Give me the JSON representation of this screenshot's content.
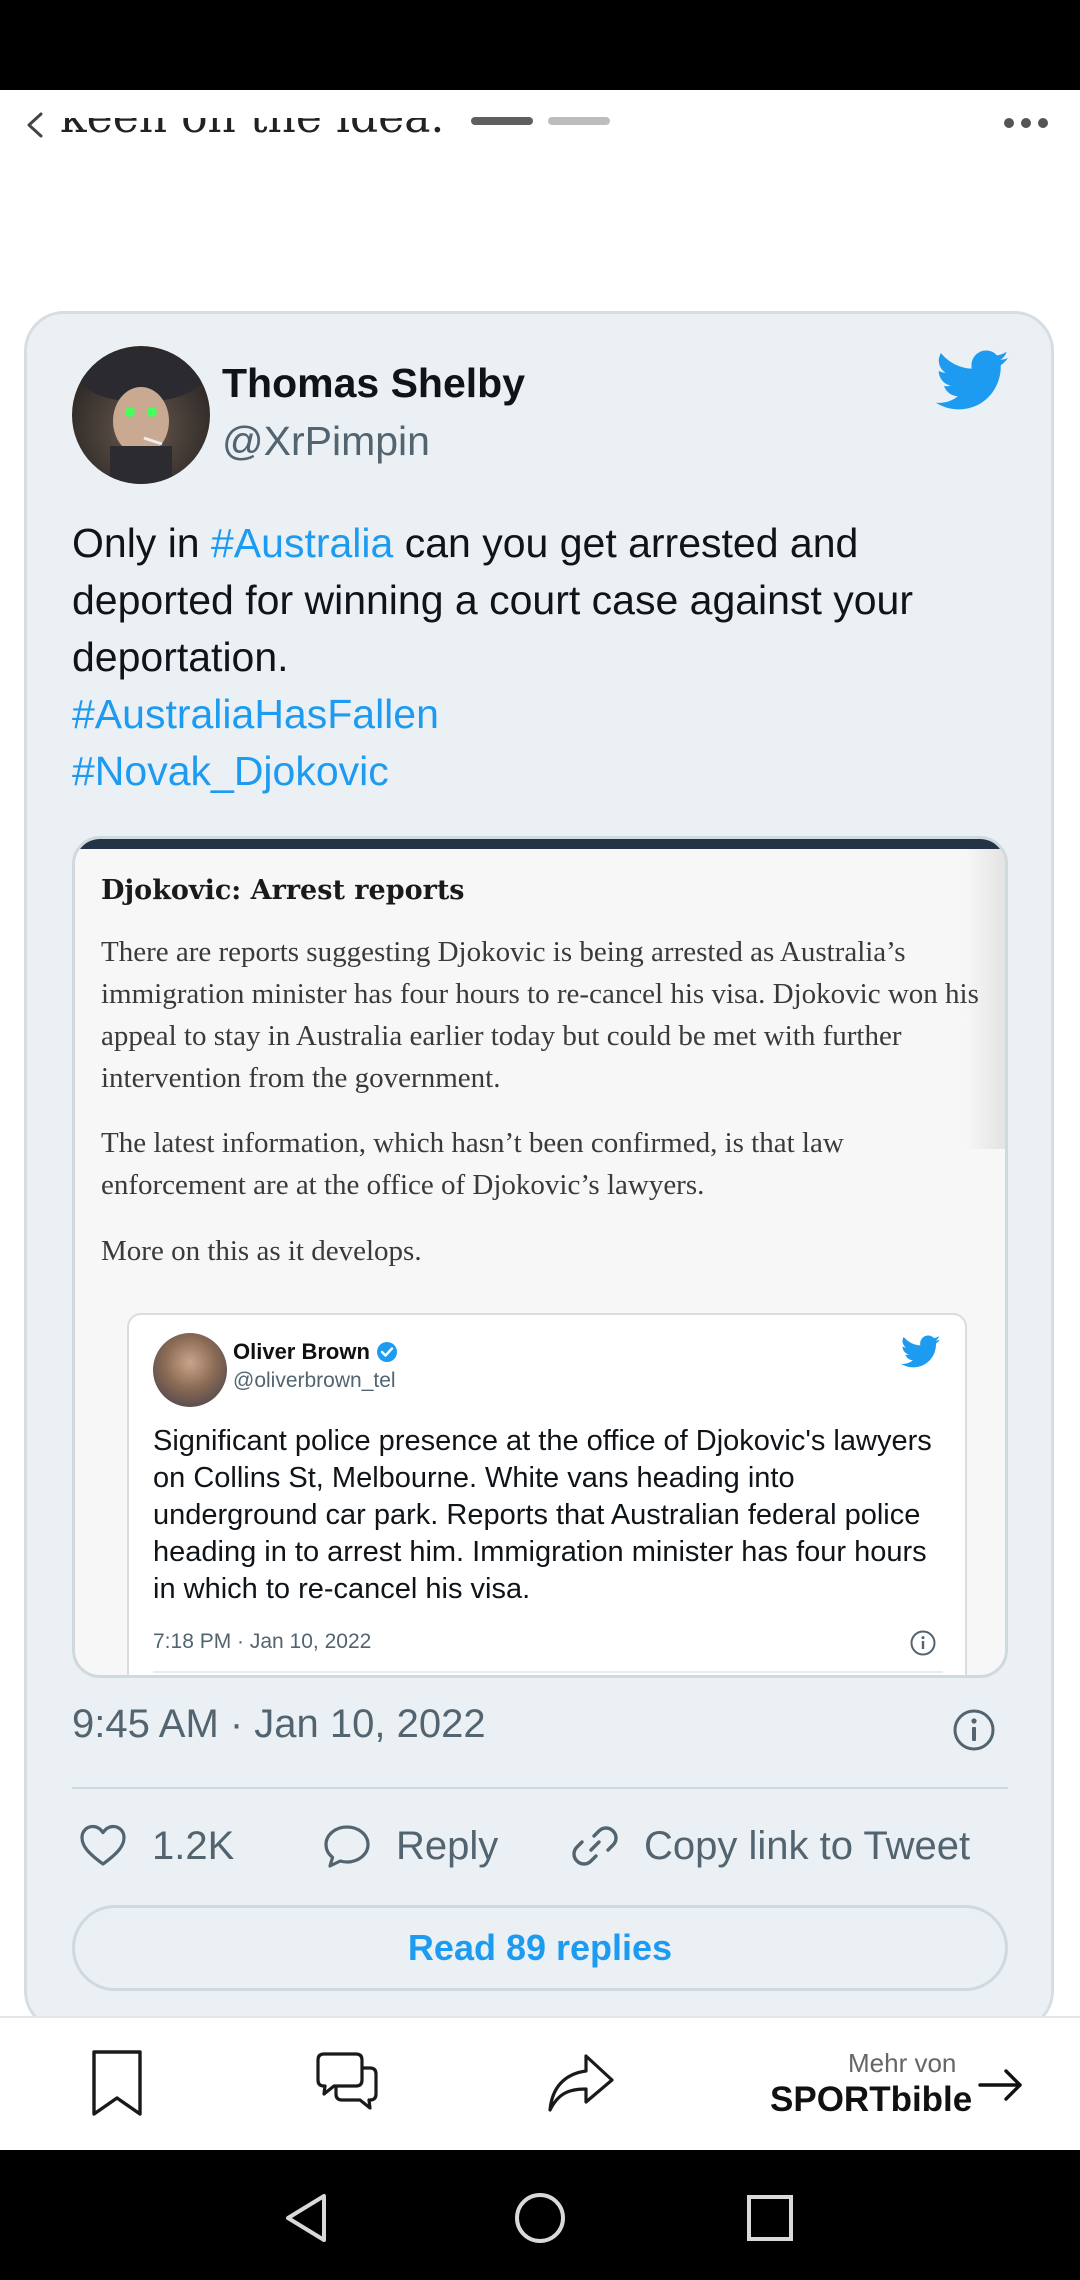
{
  "top_bar": {
    "clipped_text": "keen on the idea."
  },
  "tweet": {
    "author_name": "Thomas Shelby",
    "author_handle": "@XrPimpin",
    "text_before": "Only in ",
    "hashtag_1": "#Australia",
    "text_after": " can you get arrested and deported for winning a court case against your deportation.",
    "hashtag_2": "#AustraliaHasFallen",
    "hashtag_3": "#Novak_Djokovic",
    "timestamp": "9:45 AM · Jan 10, 2022",
    "likes": "1.2K",
    "reply_label": "Reply",
    "copy_link_label": "Copy link to Tweet",
    "read_replies_label": "Read 89 replies"
  },
  "embedded_article": {
    "title": "Djokovic: Arrest reports",
    "paragraph_1": "There are reports suggesting Djokovic is being arrested as Australia’s immigration minister has four hours to re-cancel his visa. Djokovic won his appeal to stay in Australia earlier today but could be met with further intervention from the government.",
    "paragraph_2": "The latest information, which hasn’t been confirmed, is that law enforcement are at the office of Djokovic’s lawyers.",
    "paragraph_3": "More on this as it develops.",
    "quoted_tweet": {
      "author_name": "Oliver Brown",
      "author_handle": "@oliverbrown_tel",
      "text": "Significant police presence at the office of Djokovic's lawyers on Collins St, Melbourne. White vans heading into underground car park. Reports that Australian federal police heading in to arrest him. Immigration minister has four hours in which to re-cancel his visa.",
      "timestamp": "7:18 PM · Jan 10, 2022"
    }
  },
  "bottom_bar": {
    "mehr_von_label": "Mehr von",
    "brand": "SPORTbible"
  },
  "colors": {
    "accent": "#1d9bf0",
    "card_background": "#ebf0f4",
    "secondary_text": "#536471"
  },
  "icons": [
    "back-icon",
    "more-icon",
    "twitter-bird-icon",
    "verified-icon",
    "info-icon",
    "heart-icon",
    "reply-icon",
    "link-icon",
    "bookmark-icon",
    "comments-icon",
    "share-icon",
    "arrow-right-icon",
    "nav-back-icon",
    "nav-home-icon",
    "nav-recent-icon"
  ]
}
